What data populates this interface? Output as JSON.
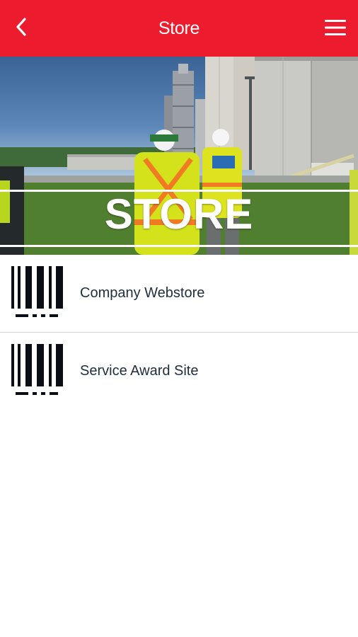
{
  "header": {
    "title": "Store",
    "back_icon": "chevron-left-icon",
    "menu_icon": "hamburger-menu-icon",
    "background_color": "#ec1b2e"
  },
  "banner": {
    "label": "STORE"
  },
  "list": {
    "items": [
      {
        "label": "Company Webstore",
        "icon": "barcode-icon"
      },
      {
        "label": "Service Award Site",
        "icon": "barcode-icon"
      }
    ]
  }
}
